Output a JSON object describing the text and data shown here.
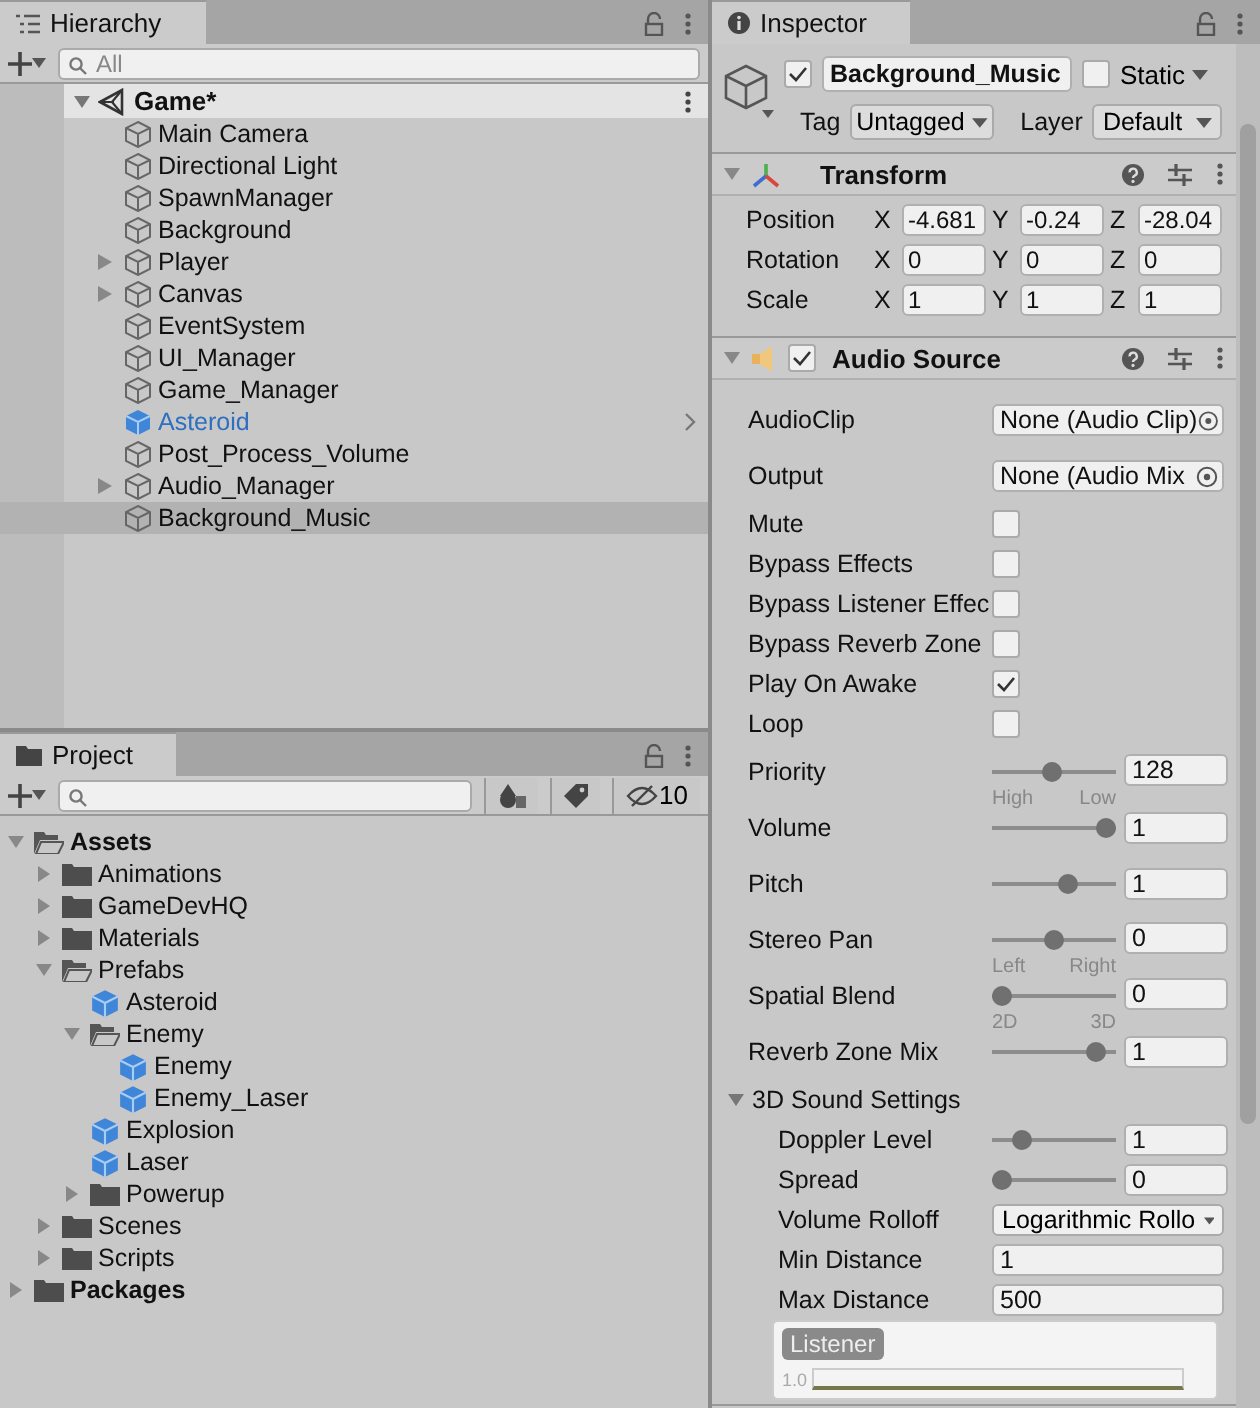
{
  "hierarchy": {
    "tab": "Hierarchy",
    "search": {
      "placeholder": "All"
    },
    "scene": {
      "name": "Game*",
      "expanded": true
    },
    "items": [
      {
        "name": "Main Camera",
        "kind": "object",
        "has_children": false,
        "selected": false
      },
      {
        "name": "Directional Light",
        "kind": "object",
        "has_children": false,
        "selected": false
      },
      {
        "name": "SpawnManager",
        "kind": "object",
        "has_children": false,
        "selected": false
      },
      {
        "name": "Background",
        "kind": "object",
        "has_children": false,
        "selected": false
      },
      {
        "name": "Player",
        "kind": "object",
        "has_children": true,
        "selected": false
      },
      {
        "name": "Canvas",
        "kind": "object",
        "has_children": true,
        "selected": false
      },
      {
        "name": "EventSystem",
        "kind": "object",
        "has_children": false,
        "selected": false
      },
      {
        "name": "UI_Manager",
        "kind": "object",
        "has_children": false,
        "selected": false
      },
      {
        "name": "Game_Manager",
        "kind": "object",
        "has_children": false,
        "selected": false
      },
      {
        "name": "Asteroid",
        "kind": "prefab",
        "has_children": false,
        "selected": false
      },
      {
        "name": "Post_Process_Volume",
        "kind": "object",
        "has_children": false,
        "selected": false
      },
      {
        "name": "Audio_Manager",
        "kind": "object",
        "has_children": true,
        "selected": false
      },
      {
        "name": "Background_Music",
        "kind": "object",
        "has_children": false,
        "selected": true
      }
    ]
  },
  "project": {
    "tab": "Project",
    "hidden_count": "10",
    "tree": [
      {
        "name": "Assets",
        "kind": "folder",
        "expanded": true,
        "children": [
          {
            "name": "Animations",
            "kind": "folder",
            "expanded": false
          },
          {
            "name": "GameDevHQ",
            "kind": "folder",
            "expanded": false
          },
          {
            "name": "Materials",
            "kind": "folder",
            "expanded": false
          },
          {
            "name": "Prefabs",
            "kind": "folder",
            "expanded": true,
            "children": [
              {
                "name": "Asteroid",
                "kind": "prefab"
              },
              {
                "name": "Enemy",
                "kind": "folder",
                "expanded": true,
                "children": [
                  {
                    "name": "Enemy",
                    "kind": "prefab"
                  },
                  {
                    "name": "Enemy_Laser",
                    "kind": "prefab"
                  }
                ]
              },
              {
                "name": "Explosion",
                "kind": "prefab"
              },
              {
                "name": "Laser",
                "kind": "prefab"
              },
              {
                "name": "Powerup",
                "kind": "folder",
                "expanded": false
              }
            ]
          },
          {
            "name": "Scenes",
            "kind": "folder",
            "expanded": false
          },
          {
            "name": "Scripts",
            "kind": "folder",
            "expanded": false
          }
        ]
      },
      {
        "name": "Packages",
        "kind": "folder",
        "expanded": false
      }
    ]
  },
  "inspector": {
    "tab": "Inspector",
    "object": {
      "name": "Background_Music",
      "active": true,
      "static": false,
      "static_label": "Static",
      "tag_label": "Tag",
      "tag": "Untagged",
      "layer_label": "Layer",
      "layer": "Default"
    },
    "components": [
      {
        "kind": "transform",
        "title": "Transform",
        "expanded": true,
        "rows": [
          {
            "label": "Position",
            "values": [
              {
                "axis": "X",
                "value": "-4.681"
              },
              {
                "axis": "Y",
                "value": "-0.24"
              },
              {
                "axis": "Z",
                "value": "-28.04"
              }
            ]
          },
          {
            "label": "Rotation",
            "values": [
              {
                "axis": "X",
                "value": "0"
              },
              {
                "axis": "Y",
                "value": "0"
              },
              {
                "axis": "Z",
                "value": "0"
              }
            ]
          },
          {
            "label": "Scale",
            "values": [
              {
                "axis": "X",
                "value": "1"
              },
              {
                "axis": "Y",
                "value": "1"
              },
              {
                "axis": "Z",
                "value": "1"
              }
            ]
          }
        ]
      },
      {
        "kind": "audio",
        "title": "Audio Source",
        "enabled": true,
        "expanded": true,
        "properties": [
          {
            "kind": "object",
            "label": "AudioClip",
            "value": "None (Audio Clip)"
          },
          {
            "kind": "object",
            "label": "Output",
            "value": "None (Audio Mix"
          },
          {
            "kind": "checkbox",
            "label": "Mute",
            "checked": false
          },
          {
            "kind": "checkbox",
            "label": "Bypass Effects",
            "checked": false
          },
          {
            "kind": "checkbox",
            "label": "Bypass Listener Effec",
            "checked": false
          },
          {
            "kind": "checkbox",
            "label": "Bypass Reverb Zone",
            "checked": false
          },
          {
            "kind": "checkbox",
            "label": "Play On Awake",
            "checked": true
          },
          {
            "kind": "checkbox",
            "label": "Loop",
            "checked": false
          },
          {
            "kind": "slider",
            "label": "Priority",
            "level": 0.49,
            "value": "128",
            "min_label": "High",
            "max_label": "Low"
          },
          {
            "kind": "slider",
            "label": "Volume",
            "level": 1,
            "value": "1"
          },
          {
            "kind": "slider",
            "label": "Pitch",
            "level": 0.64,
            "value": "1"
          },
          {
            "kind": "slider",
            "label": "Stereo Pan",
            "level": 0.5,
            "value": "0",
            "min_label": "Left",
            "max_label": "Right"
          },
          {
            "kind": "slider",
            "label": "Spatial Blend",
            "level": 0,
            "value": "0",
            "min_label": "2D",
            "max_label": "3D"
          },
          {
            "kind": "slider",
            "label": "Reverb Zone Mix",
            "level": 0.91,
            "value": "1"
          },
          {
            "kind": "section",
            "label": "3D Sound Settings",
            "expanded": true,
            "children": [
              {
                "kind": "slider",
                "label": "Doppler Level",
                "level": 0.2,
                "value": "1"
              },
              {
                "kind": "slider",
                "label": "Spread",
                "level": 0,
                "value": "0"
              },
              {
                "kind": "dropdown",
                "label": "Volume Rolloff",
                "value": "Logarithmic Rollo"
              },
              {
                "kind": "number",
                "label": "Min Distance",
                "value": "1"
              },
              {
                "kind": "number",
                "label": "Max Distance",
                "value": "500"
              },
              {
                "kind": "graph",
                "label": "Listener",
                "y_tick": "1.0"
              }
            ]
          }
        ]
      }
    ]
  }
}
